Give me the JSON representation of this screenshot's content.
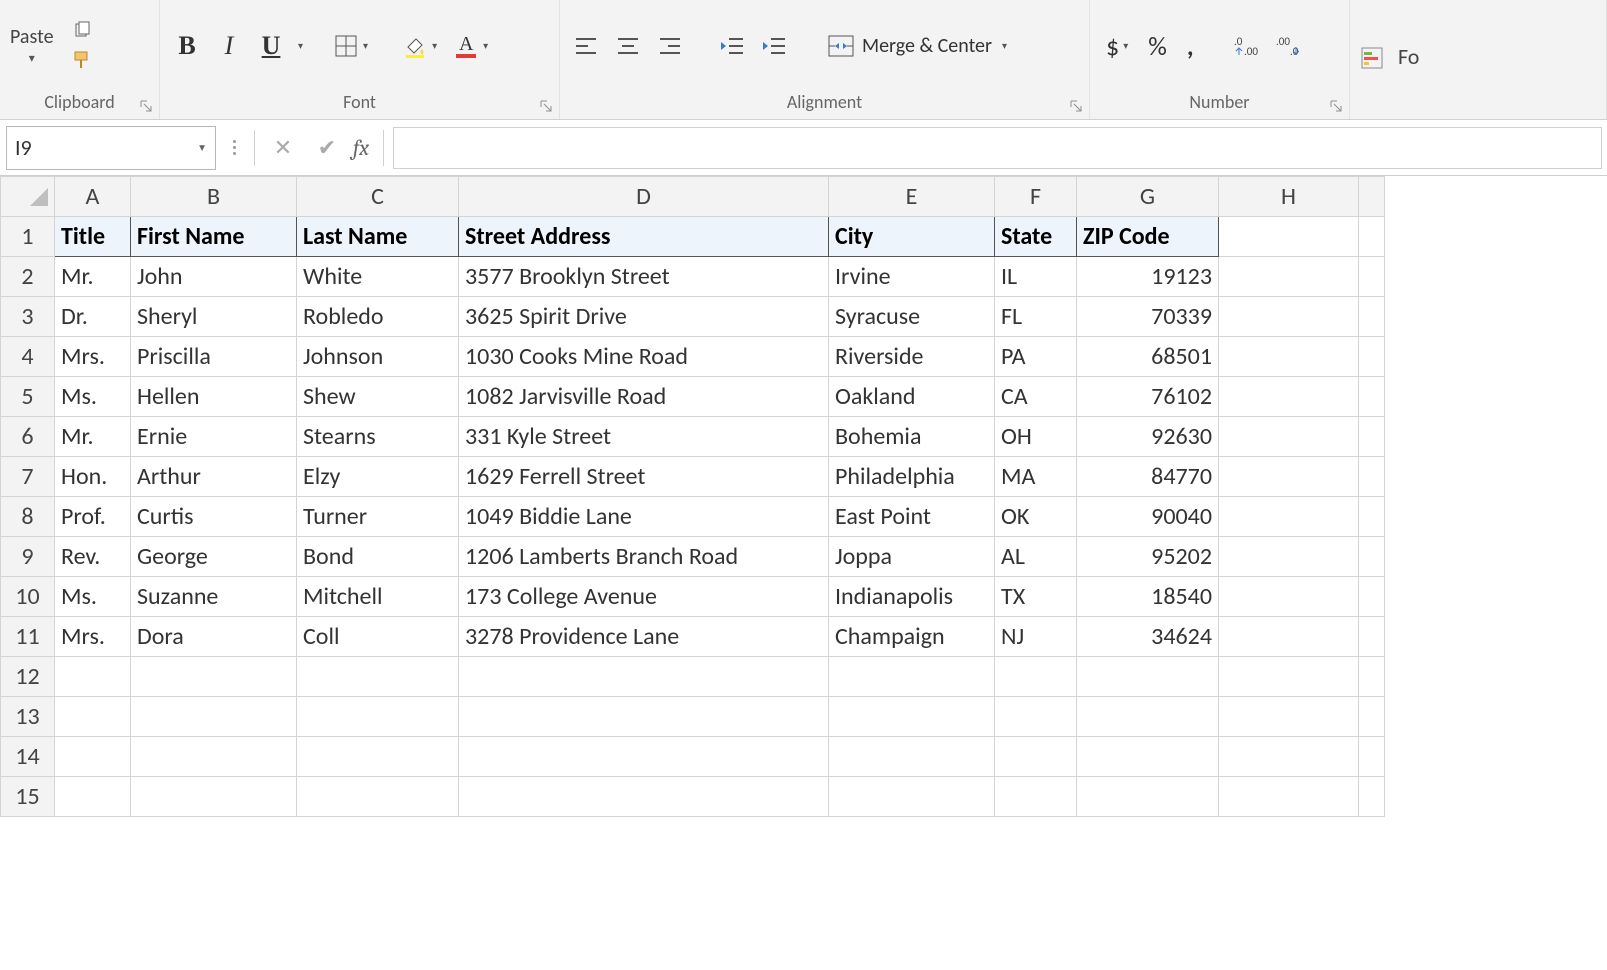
{
  "ribbon": {
    "clipboard": {
      "paste": "Paste",
      "label": "Clipboard"
    },
    "font": {
      "bold": "B",
      "italic": "I",
      "underline": "U",
      "label": "Font"
    },
    "alignment": {
      "merge": "Merge & Center",
      "label": "Alignment"
    },
    "number": {
      "currency": "$",
      "percent": "%",
      "comma": ",",
      "label": "Number"
    },
    "styles": {
      "format_hint": "Fo"
    }
  },
  "formula_bar": {
    "cell_ref": "I9",
    "fx": "fx",
    "formula": ""
  },
  "grid": {
    "columns": [
      "A",
      "B",
      "C",
      "D",
      "E",
      "F",
      "G",
      "H",
      ""
    ],
    "row_numbers": [
      1,
      2,
      3,
      4,
      5,
      6,
      7,
      8,
      9,
      10,
      11,
      12,
      13,
      14,
      15
    ],
    "headers": [
      "Title",
      "First Name",
      "Last Name",
      "Street Address",
      "City",
      "State",
      "ZIP Code"
    ],
    "rows": [
      {
        "title": "Mr.",
        "first": "John",
        "last": "White",
        "street": "3577 Brooklyn Street",
        "city": "Irvine",
        "state": "IL",
        "zip": "19123"
      },
      {
        "title": "Dr.",
        "first": "Sheryl",
        "last": "Robledo",
        "street": "3625 Spirit Drive",
        "city": "Syracuse",
        "state": "FL",
        "zip": "70339"
      },
      {
        "title": "Mrs.",
        "first": "Priscilla",
        "last": "Johnson",
        "street": "1030 Cooks Mine Road",
        "city": "Riverside",
        "state": "PA",
        "zip": "68501"
      },
      {
        "title": "Ms.",
        "first": "Hellen",
        "last": "Shew",
        "street": "1082 Jarvisville Road",
        "city": "Oakland",
        "state": "CA",
        "zip": "76102"
      },
      {
        "title": "Mr.",
        "first": "Ernie",
        "last": "Stearns",
        "street": "331 Kyle Street",
        "city": "Bohemia",
        "state": "OH",
        "zip": "92630"
      },
      {
        "title": "Hon.",
        "first": "Arthur",
        "last": "Elzy",
        "street": "1629 Ferrell Street",
        "city": "Philadelphia",
        "state": "MA",
        "zip": "84770"
      },
      {
        "title": "Prof.",
        "first": "Curtis",
        "last": "Turner",
        "street": "1049 Biddie Lane",
        "city": "East Point",
        "state": "OK",
        "zip": "90040"
      },
      {
        "title": "Rev.",
        "first": "George",
        "last": "Bond",
        "street": "1206 Lamberts Branch Road",
        "city": "Joppa",
        "state": "AL",
        "zip": "95202"
      },
      {
        "title": "Ms.",
        "first": "Suzanne",
        "last": "Mitchell",
        "street": "173 College Avenue",
        "city": "Indianapolis",
        "state": "TX",
        "zip": "18540"
      },
      {
        "title": "Mrs.",
        "first": "Dora",
        "last": "Coll",
        "street": "3278 Providence Lane",
        "city": "Champaign",
        "state": "NJ",
        "zip": "34624"
      }
    ]
  }
}
